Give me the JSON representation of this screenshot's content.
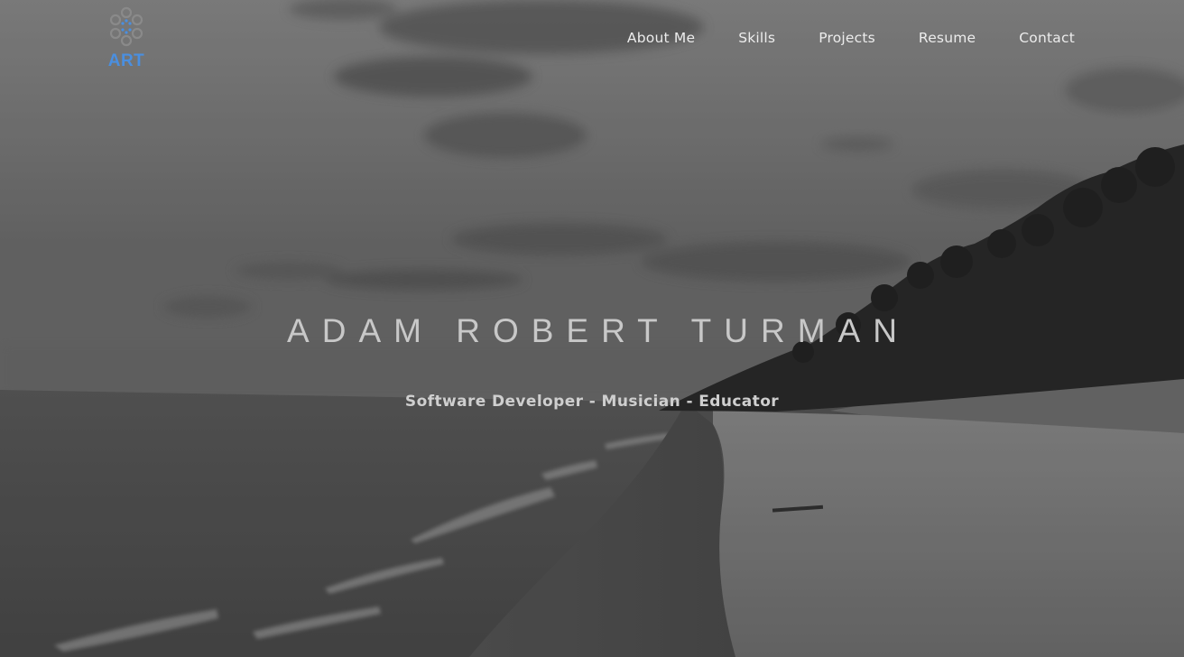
{
  "brand": {
    "logo_text": "ART",
    "logo_color": "#4a8fe0",
    "logo_icon": "circle-ring-icon"
  },
  "nav": {
    "items": [
      {
        "label": "About Me"
      },
      {
        "label": "Skills"
      },
      {
        "label": "Projects"
      },
      {
        "label": "Resume"
      },
      {
        "label": "Contact"
      }
    ]
  },
  "hero": {
    "title": "ADAM ROBERT TURMAN",
    "subtitle": "Software Developer - Musician - Educator",
    "background": "grayscale beach photo"
  }
}
